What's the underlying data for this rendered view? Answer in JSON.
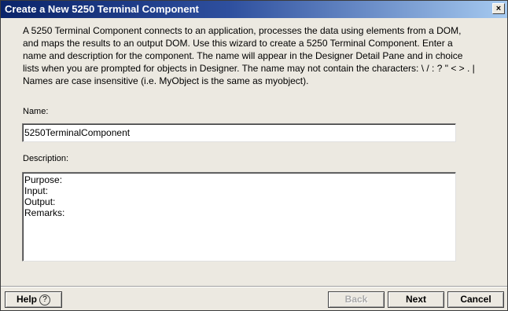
{
  "window": {
    "title": "Create a New 5250 Terminal Component",
    "close_glyph": "×"
  },
  "description_lines": [
    "A 5250 Terminal Component connects to an application, processes the data using elements from a DOM,",
    "and maps the results to an output DOM.  Use this wizard to create a 5250 Terminal Component.  Enter a",
    "name and description for the component.  The name will appear in the Designer Detail Pane and in choice",
    "lists when you are prompted for objects in Designer.  The name may not contain the characters: \\ / : ? \" < > . |",
    "Names are case insensitive (i.e. MyObject is the same as myobject)."
  ],
  "form": {
    "name_label": "Name:",
    "name_value": "5250TerminalComponent",
    "description_label": "Description:",
    "description_lines": [
      "Purpose:",
      "Input:",
      "Output:",
      "Remarks:"
    ]
  },
  "buttons": {
    "help": "Help",
    "help_icon": "?",
    "back": "Back",
    "next": "Next",
    "cancel": "Cancel"
  }
}
